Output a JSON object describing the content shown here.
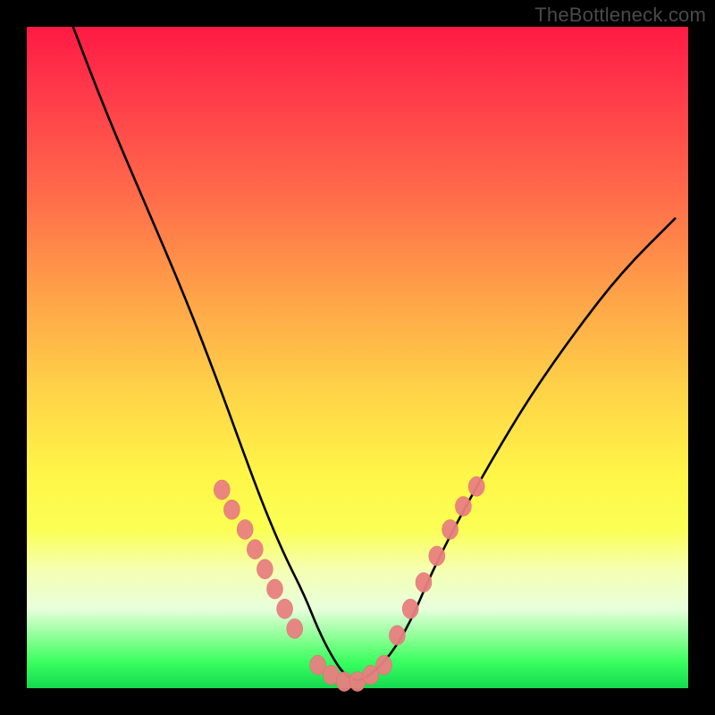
{
  "watermark": "TheBottleneck.com",
  "chart_data": {
    "type": "line",
    "title": "",
    "xlabel": "",
    "ylabel": "",
    "xlim": [
      0,
      100
    ],
    "ylim": [
      0,
      100
    ],
    "series": [
      {
        "name": "bottleneck-curve",
        "x": [
          7,
          12,
          18,
          24,
          29,
          33,
          36,
          39,
          42,
          44,
          46,
          48,
          50,
          52,
          55,
          58,
          61,
          65,
          70,
          76,
          83,
          90,
          98
        ],
        "y": [
          100,
          87,
          73,
          59,
          46,
          35,
          27,
          20,
          14,
          9,
          5,
          2,
          1,
          2,
          5,
          10,
          17,
          25,
          34,
          44,
          54,
          63,
          71
        ]
      }
    ],
    "markers": [
      {
        "name": "left-cluster",
        "x": [
          29.5,
          31,
          33,
          34.5,
          36,
          37.5,
          39,
          40.5
        ],
        "y": [
          30,
          27,
          24,
          21,
          18,
          15,
          12,
          9
        ]
      },
      {
        "name": "bottom-cluster",
        "x": [
          44,
          46,
          48,
          50,
          52,
          54
        ],
        "y": [
          3.5,
          2,
          1,
          1,
          2,
          3.5
        ]
      },
      {
        "name": "right-cluster",
        "x": [
          56,
          58,
          60,
          62,
          64,
          66,
          68
        ],
        "y": [
          8,
          12,
          16,
          20,
          24,
          27.5,
          30.5
        ]
      }
    ],
    "colors": {
      "curve": "#000000",
      "marker_fill": "#e98080",
      "marker_stroke": "#d86a6a"
    }
  }
}
